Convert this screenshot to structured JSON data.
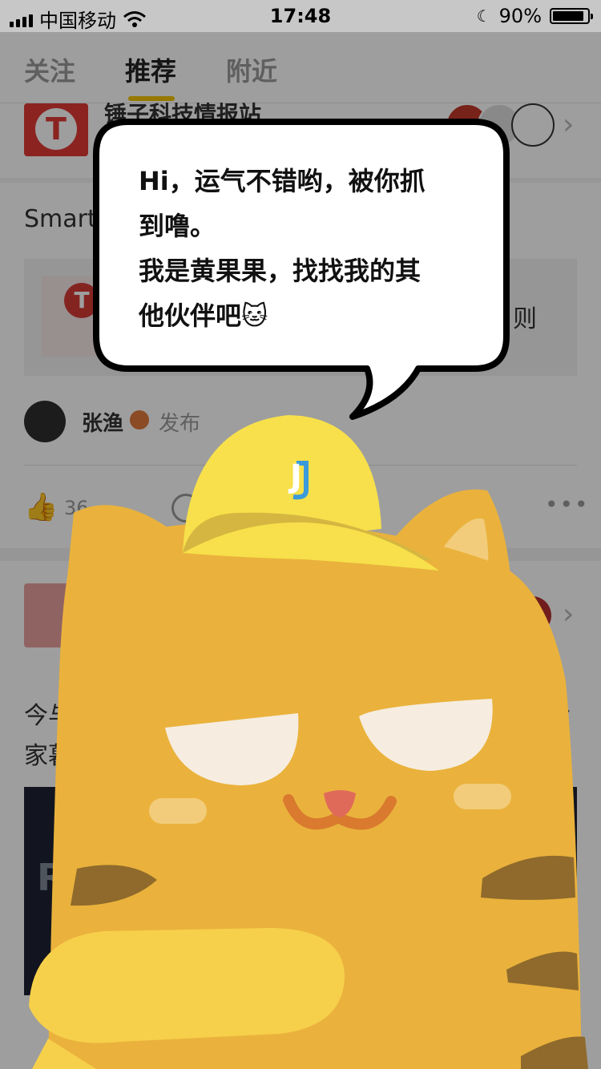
{
  "status_bar": {
    "carrier": "中国移动",
    "time": "17:48",
    "battery": "90%",
    "battery_level": 0.9
  },
  "tabs": [
    {
      "label": "关注"
    },
    {
      "label": "推荐"
    },
    {
      "label": "附近"
    }
  ],
  "feed": {
    "card1": {
      "source_name": "锤子科技情报站",
      "content_start": "Smart",
      "content_right": "则"
    },
    "author": {
      "name": "张渔",
      "action": "发布"
    },
    "likes": "36",
    "card2": {
      "content_line1_start": "今与",
      "content_line1_end": "大",
      "content_line2_start": "家暮",
      "image_text": "RE"
    }
  },
  "mascot": {
    "bubble_lines": [
      "Hi，运气不错哟，被你抓",
      "到噜。",
      "我是黄果果，找找我的其",
      "他伙伴吧🐱"
    ],
    "cap_letter": "J"
  }
}
